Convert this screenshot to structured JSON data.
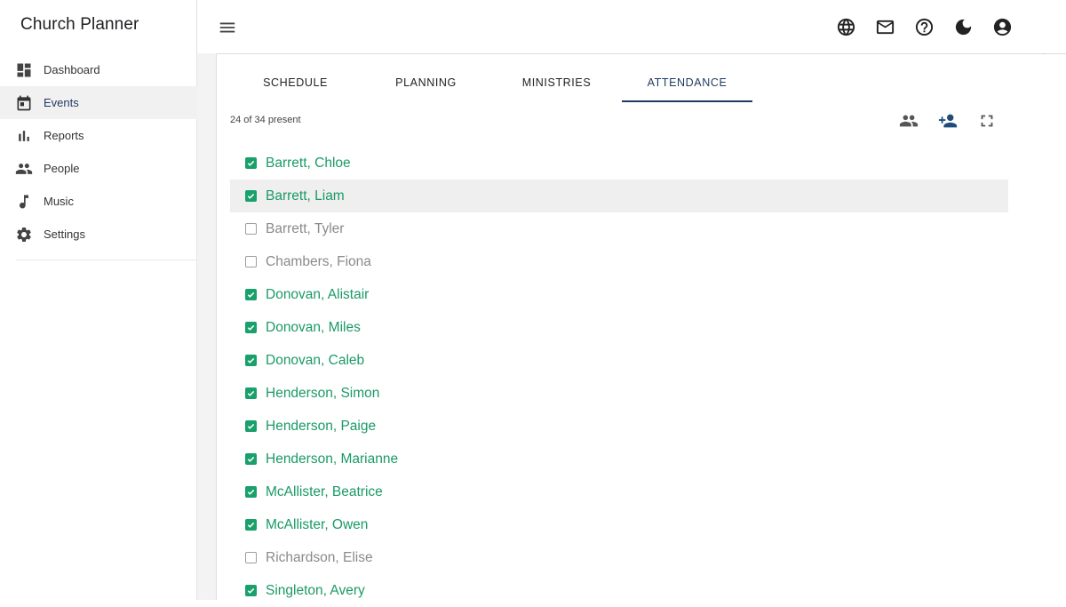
{
  "app": {
    "title": "Church Planner"
  },
  "sidebar": {
    "items": [
      {
        "label": "Dashboard",
        "icon": "dashboard-icon",
        "active": false
      },
      {
        "label": "Events",
        "icon": "calendar-icon",
        "active": true
      },
      {
        "label": "Reports",
        "icon": "bar-chart-icon",
        "active": false
      },
      {
        "label": "People",
        "icon": "people-icon",
        "active": false
      },
      {
        "label": "Music",
        "icon": "music-note-icon",
        "active": false
      },
      {
        "label": "Settings",
        "icon": "gear-icon",
        "active": false
      }
    ]
  },
  "topbar": {
    "icons": [
      "globe-icon",
      "mail-icon",
      "help-icon",
      "dark-mode-icon",
      "account-icon"
    ]
  },
  "tabs": [
    {
      "label": "SCHEDULE",
      "active": false
    },
    {
      "label": "PLANNING",
      "active": false
    },
    {
      "label": "MINISTRIES",
      "active": false
    },
    {
      "label": "ATTENDANCE",
      "active": true
    }
  ],
  "attendance": {
    "summary": "24 of 34 present",
    "tools": [
      "group-icon",
      "add-person-icon",
      "fullscreen-icon"
    ],
    "accent_color": "#1aa06b",
    "people": [
      {
        "name": "Barrett, Chloe",
        "present": true
      },
      {
        "name": "Barrett, Liam",
        "present": true
      },
      {
        "name": "Barrett, Tyler",
        "present": false
      },
      {
        "name": "Chambers, Fiona",
        "present": false
      },
      {
        "name": "Donovan, Alistair",
        "present": true
      },
      {
        "name": "Donovan, Miles",
        "present": true
      },
      {
        "name": "Donovan, Caleb",
        "present": true
      },
      {
        "name": "Henderson, Simon",
        "present": true
      },
      {
        "name": "Henderson, Paige",
        "present": true
      },
      {
        "name": "Henderson, Marianne",
        "present": true
      },
      {
        "name": "McAllister, Beatrice",
        "present": true
      },
      {
        "name": "McAllister, Owen",
        "present": true
      },
      {
        "name": "Richardson, Elise",
        "present": false
      },
      {
        "name": "Singleton, Avery",
        "present": true
      }
    ]
  }
}
